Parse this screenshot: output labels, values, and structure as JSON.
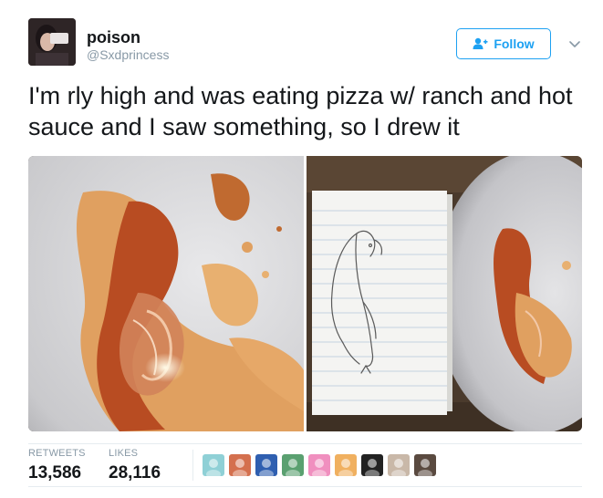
{
  "user": {
    "display_name": "poison",
    "handle": "@Sxdprincess",
    "avatar_icon": "profile-photo"
  },
  "follow": {
    "label": "Follow",
    "icon": "add-user-icon",
    "accent": "#1da1f2"
  },
  "more_menu_icon": "chevron-down-icon",
  "tweet": {
    "text": "I'm rly high and was eating pizza w/ ranch and hot sauce and I saw something, so I drew it"
  },
  "media": [
    {
      "name": "plate-sauce-photo"
    },
    {
      "name": "notebook-drawing-photo"
    }
  ],
  "stats": {
    "retweets_label": "RETWEETS",
    "retweets_count": "13,586",
    "likes_label": "LIKES",
    "likes_count": "28,116"
  },
  "liked_by_avatars": [
    {
      "name": "liker-avatar-1",
      "color": "#8fd0d6"
    },
    {
      "name": "liker-avatar-2",
      "color": "#d4704e"
    },
    {
      "name": "liker-avatar-3",
      "color": "#2f5fb0"
    },
    {
      "name": "liker-avatar-4",
      "color": "#5aa070"
    },
    {
      "name": "liker-avatar-5",
      "color": "#f08fbf"
    },
    {
      "name": "liker-avatar-6",
      "color": "#f0b060"
    },
    {
      "name": "liker-avatar-7",
      "color": "#222222"
    },
    {
      "name": "liker-avatar-8",
      "color": "#c9b8a8"
    },
    {
      "name": "liker-avatar-9",
      "color": "#5a4a40"
    }
  ]
}
